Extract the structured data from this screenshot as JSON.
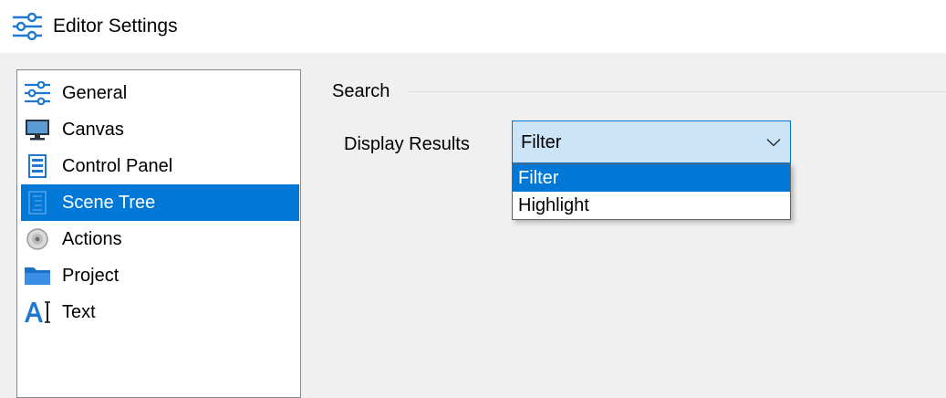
{
  "window": {
    "title": "Editor Settings",
    "icon": "settings-sliders-icon"
  },
  "sidebar": {
    "items": [
      {
        "label": "General",
        "icon": "sliders-icon",
        "selected": false
      },
      {
        "label": "Canvas",
        "icon": "monitor-icon",
        "selected": false
      },
      {
        "label": "Control Panel",
        "icon": "panel-icon",
        "selected": false
      },
      {
        "label": "Scene Tree",
        "icon": "tree-icon",
        "selected": true
      },
      {
        "label": "Actions",
        "icon": "disc-icon",
        "selected": false
      },
      {
        "label": "Project",
        "icon": "folder-icon",
        "selected": false
      },
      {
        "label": "Text",
        "icon": "text-cursor-icon",
        "selected": false
      }
    ]
  },
  "main": {
    "group_title": "Search",
    "display_results": {
      "label": "Display Results",
      "value": "Filter",
      "options": [
        "Filter",
        "Highlight"
      ],
      "highlighted_option": "Filter"
    }
  },
  "colors": {
    "accent": "#0078d7",
    "combo_background": "#cce4f7",
    "window_background": "#f0f0f0",
    "icon_blue": "#1e78d2"
  }
}
